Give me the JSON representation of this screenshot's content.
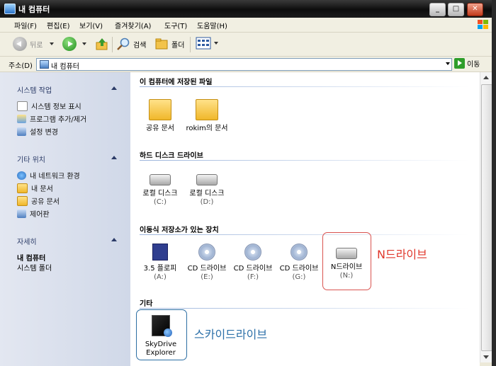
{
  "window": {
    "title": "내 컴퓨터",
    "buttons": [
      "_",
      "□",
      "✕"
    ]
  },
  "menu": [
    "파일(F)",
    "편집(E)",
    "보기(V)",
    "즐겨찾기(A)",
    "도구(T)",
    "도움말(H)"
  ],
  "toolbar": {
    "back": "뒤로",
    "search": "검색",
    "folders": "폴더"
  },
  "address": {
    "label": "주소(D)",
    "value": "내 컴퓨터",
    "go": "이동"
  },
  "left": {
    "system_tasks": {
      "title": "시스템 작업",
      "items": [
        "시스템 정보 표시",
        "프로그램 추가/제거",
        "설정 변경"
      ]
    },
    "other_places": {
      "title": "기타 위치",
      "items": [
        "내 네트워크 환경",
        "내 문서",
        "공유 문서",
        "제어판"
      ]
    },
    "details": {
      "title": "자세히",
      "name": "내 컴퓨터",
      "type": "시스템 폴더"
    }
  },
  "sections": {
    "files": {
      "title": "이 컴퓨터에 저장된 파일",
      "items": [
        "공유 문서",
        "rokim의 문서"
      ]
    },
    "hdd": {
      "title": "하드 디스크 드라이브",
      "items": [
        {
          "name": "로컬 디스크",
          "drive": "(C:)"
        },
        {
          "name": "로컬 디스크",
          "drive": "(D:)"
        }
      ]
    },
    "removable": {
      "title": "이동식 저장소가 있는 장치",
      "items": [
        {
          "name": "3.5 플로피",
          "drive": "(A:)"
        },
        {
          "name": "CD 드라이브",
          "drive": "(E:)"
        },
        {
          "name": "CD 드라이브",
          "drive": "(F:)"
        },
        {
          "name": "CD 드라이브",
          "drive": "(G:)"
        },
        {
          "name": "N드라이브",
          "drive": "(N:)"
        }
      ]
    },
    "other": {
      "title": "기타",
      "items": [
        {
          "name": "SkyDrive",
          "name2": "Explorer"
        }
      ]
    }
  },
  "annotations": {
    "n_drive": "N드라이브",
    "skydrive": "스카이드라이브"
  },
  "colors": {
    "annotation_red": "#e0372b",
    "annotation_blue": "#2b6fa8",
    "task_pane": "#d6dff0"
  }
}
